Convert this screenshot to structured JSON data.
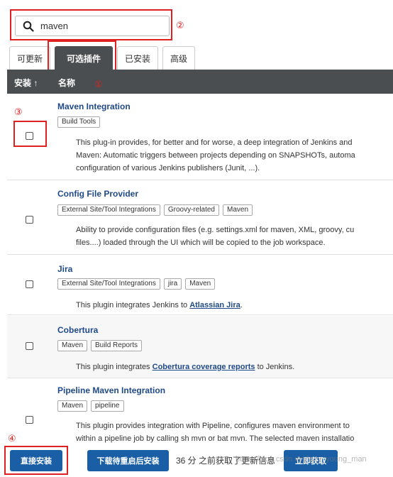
{
  "search": {
    "value": "maven"
  },
  "tabs": [
    "可更新",
    "可选插件",
    "已安装",
    "高级"
  ],
  "table_header": {
    "install": "安装 ↑",
    "name": "名称"
  },
  "annotations": [
    "②",
    "①",
    "③",
    "④"
  ],
  "plugins": [
    {
      "title": "Maven Integration",
      "tags": [
        "Build Tools"
      ],
      "desc_lines": [
        "This plug-in provides, for better and for worse, a deep integration of Jenkins and",
        "Maven: Automatic triggers between projects depending on SNAPSHOTs, automa",
        "configuration of various Jenkins publishers (Junit, ...)."
      ]
    },
    {
      "title": "Config File Provider",
      "tags": [
        "External Site/Tool Integrations",
        "Groovy-related",
        "Maven"
      ],
      "desc_lines": [
        "Ability to provide configuration files (e.g. settings.xml for maven, XML, groovy, cu",
        "files....) loaded through the UI which will be copied to the job workspace."
      ]
    },
    {
      "title": "Jira",
      "tags": [
        "External Site/Tool Integrations",
        "jira",
        "Maven"
      ],
      "desc_prefix": "This plugin integrates Jenkins to ",
      "desc_link": "Atlassian Jira",
      "desc_suffix": "."
    },
    {
      "title": "Cobertura",
      "tags": [
        "Maven",
        "Build Reports"
      ],
      "desc_prefix": "This plugin integrates ",
      "desc_link": "Cobertura coverage reports",
      "desc_suffix": " to Jenkins."
    },
    {
      "title": "Pipeline Maven Integration",
      "tags": [
        "Maven",
        "pipeline"
      ],
      "desc_lines": [
        "This plugin provides integration with Pipeline, configures maven environment to",
        "within a pipeline job by calling sh mvn or bat mvn. The selected maven installatio"
      ]
    }
  ],
  "bottom": {
    "install_now": "直接安装",
    "install_after_restart": "下载待重启后安装",
    "status": "36 分 之前获取了更新信息",
    "check_now": "立即获取",
    "watermark": "https://blog.csdn.net/lazy_young_man"
  }
}
